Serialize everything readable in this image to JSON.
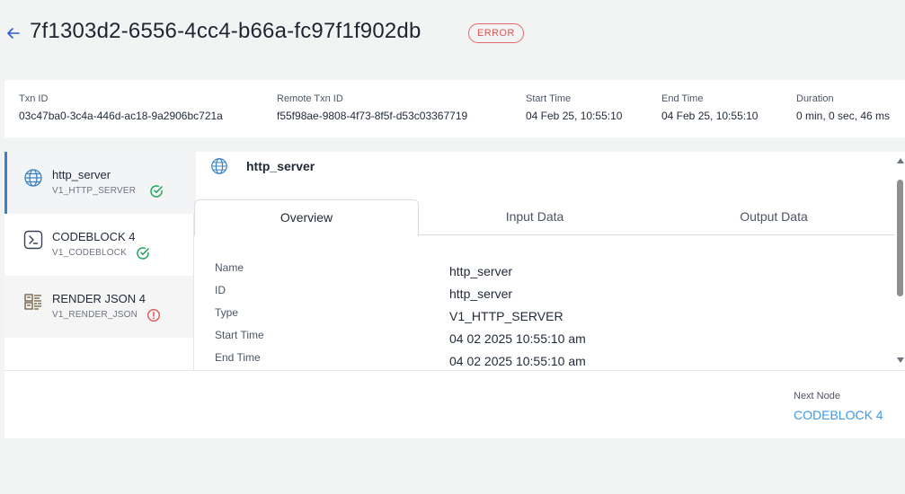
{
  "header": {
    "title": "7f1303d2-6556-4cc4-b66a-fc97f1f902db",
    "status": "ERROR"
  },
  "summary": [
    {
      "label": "Txn ID",
      "value": "03c47ba0-3c4a-446d-ac18-9a2906bc721a"
    },
    {
      "label": "Remote Txn ID",
      "value": "f55f98ae-9808-4f73-8f5f-d53c03367719"
    },
    {
      "label": "Start Time",
      "value": "04 Feb 25, 10:55:10"
    },
    {
      "label": "End Time",
      "value": "04 Feb 25, 10:55:10"
    },
    {
      "label": "Duration",
      "value": "0 min, 0 sec, 46 ms"
    }
  ],
  "nodes": [
    {
      "title": "http_server",
      "subtitle": "V1_HTTP_SERVER",
      "icon": "globe-icon",
      "status": "success"
    },
    {
      "title": "CODEBLOCK 4",
      "subtitle": "V1_CODEBLOCK",
      "icon": "terminal-icon",
      "status": "success"
    },
    {
      "title": "RENDER JSON 4",
      "subtitle": "V1_RENDER_JSON",
      "icon": "render-json-icon",
      "status": "error"
    }
  ],
  "content": {
    "title": "http_server",
    "tabs": [
      "Overview",
      "Input Data",
      "Output Data"
    ],
    "active_tab": "Overview",
    "details": [
      {
        "label": "Name",
        "value": "http_server"
      },
      {
        "label": "ID",
        "value": "http_server"
      },
      {
        "label": "Type",
        "value": "V1_HTTP_SERVER"
      },
      {
        "label": "Start Time",
        "value": "04 02 2025 10:55:10 am"
      },
      {
        "label": "End Time",
        "value": "04 02 2025 10:55:10 am"
      }
    ]
  },
  "footer": {
    "next_label": "Next Node",
    "next_value": "CODEBLOCK 4"
  },
  "colors": {
    "accent": "#3b9ae8",
    "success": "#22a55b",
    "error": "#e05454",
    "active_border": "#3b82c4"
  }
}
